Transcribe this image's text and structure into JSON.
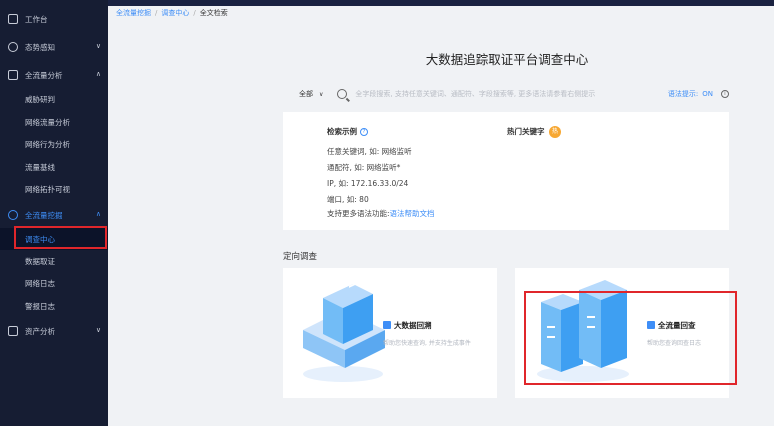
{
  "sidebar": {
    "items": [
      {
        "label": "工作台",
        "icon": "dashboard-icon"
      },
      {
        "label": "态势感知",
        "icon": "situation-icon",
        "chevron": "∨"
      },
      {
        "label": "全流量分析",
        "icon": "analysis-icon",
        "chevron": "∧"
      },
      {
        "label": "全流量挖掘",
        "icon": "mining-icon",
        "chevron": "∧"
      },
      {
        "label": "资产分析",
        "icon": "asset-icon",
        "chevron": "∨"
      }
    ],
    "analysis_sub": [
      "威胁研判",
      "网络流量分析",
      "网络行为分析",
      "流量基线",
      "网络拓扑可视"
    ],
    "mining_sub": [
      "调查中心",
      "数据取证",
      "网络日志",
      "警报日志"
    ]
  },
  "breadcrumb": {
    "items": [
      "全流量挖掘",
      "调查中心",
      "全文检索"
    ],
    "separator": "/"
  },
  "main": {
    "title": "大数据追踪取证平台调查中心",
    "search": {
      "scope": "全部",
      "scope_chevron": "∨",
      "placeholder": "全字段搜索, 支持任意关键词、通配符、字段搜索等, 更多语法请参看右侧提示",
      "hint_label": "语法提示:",
      "hint_state": "ON",
      "info_glyph": "i"
    },
    "examples": {
      "title": "检索示例",
      "help_glyph": "?",
      "lines": [
        "任意关键词, 如: 网络监听",
        "通配符, 如: 网络监听*",
        "IP, 如: 172.16.33.0/24",
        "端口, 如: 80"
      ],
      "more_prefix": "支持更多语法功能:",
      "more_link": "语法帮助文档"
    },
    "hot": {
      "title": "热门关键字",
      "badge": "热"
    },
    "section_title": "定向调查",
    "cards": [
      {
        "title": "大数据回溯",
        "desc": "帮助您快速查询, 并支持生成事件"
      },
      {
        "title": "全流量回查",
        "desc": "帮助您查询回查日志"
      }
    ]
  },
  "colors": {
    "sidebar_bg": "#161d33",
    "accent": "#3e8ef7",
    "highlight_red": "#e0262b",
    "hot_orange": "#f7a833"
  }
}
